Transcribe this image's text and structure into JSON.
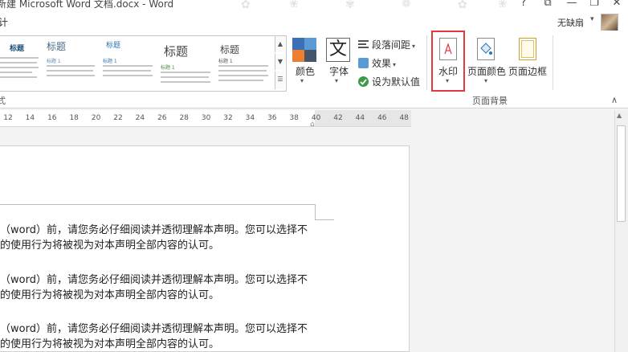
{
  "titlebar": {
    "title": "新建 Microsoft Word 文档.docx - Word",
    "help": "?",
    "ribbon_display": "⧉",
    "minimize": "—",
    "restore": "❐",
    "close": "✕"
  },
  "menu": {
    "tab_partial": "计"
  },
  "user": {
    "name": "无缺扇",
    "caret": "▾"
  },
  "styles_gallery": {
    "items": [
      {
        "heading": "标题"
      },
      {
        "heading": "标题",
        "sub": "标题 1"
      },
      {
        "heading": "标题",
        "sub": "标题 1"
      },
      {
        "heading": "标题",
        "sub": "标题 1"
      },
      {
        "heading": "标题",
        "sub": "标题 1"
      }
    ],
    "group_label": "式"
  },
  "ribbon": {
    "colors_label": "颜色",
    "fonts_label": "字体",
    "font_glyph": "文",
    "paragraph_spacing_label": "段落间距",
    "effects_label": "效果",
    "set_default_label": "设为默认值",
    "watermark_label": "水印",
    "page_color_label": "页面颜色",
    "page_borders_label": "页面边框",
    "page_background_group": "页面背景",
    "dropdown": "▾",
    "collapse": "∧"
  },
  "ruler": {
    "ticks": [
      "12",
      "14",
      "16",
      "18",
      "20",
      "22",
      "24",
      "26",
      "28",
      "30",
      "32",
      "34",
      "36",
      "38",
      "40",
      "42",
      "44",
      "46",
      "48"
    ]
  },
  "document": {
    "paragraphs": [
      {
        "line1": "（word）前，请您务必仔细阅读并透彻理解本声明。您可以选择不",
        "line2": "的使用行为将被视为对本声明全部内容的认可。"
      },
      {
        "line1": "（word）前，请您务必仔细阅读并透彻理解本声明。您可以选择不",
        "line2": "的使用行为将被视为对本声明全部内容的认可。"
      },
      {
        "line1": "（word）前，请您务必仔细阅读并透彻理解本声明。您可以选择不",
        "line2": "的使用行为将被视为对本声明全部内容的认可。"
      }
    ]
  },
  "colors": {
    "accent_red": "#e0393e",
    "title_blue": "#1f4e79"
  }
}
